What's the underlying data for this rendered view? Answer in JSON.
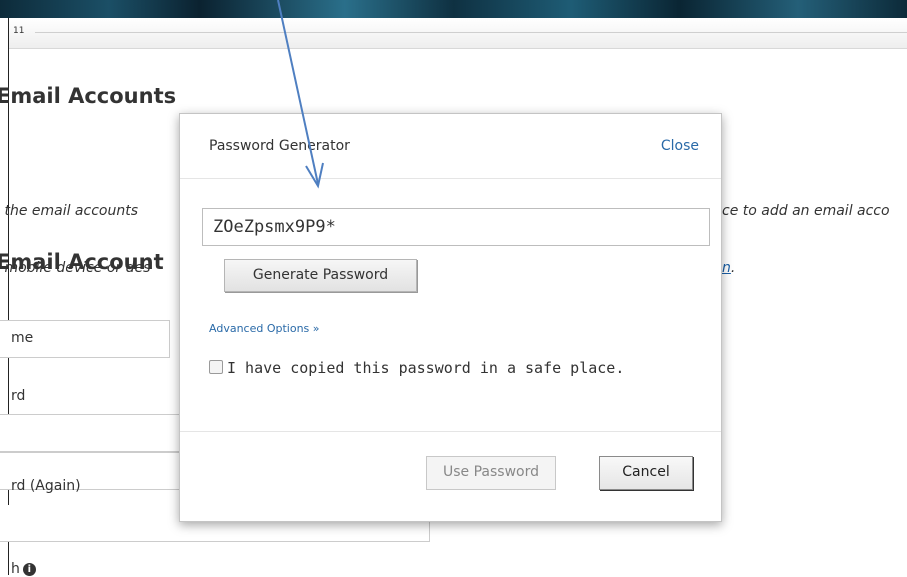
{
  "browser": {
    "tab_number": "11"
  },
  "page": {
    "title": "Email Accounts",
    "intro_left_line1": " the email accounts",
    "intro_left_line2": " mobile device or des",
    "intro_right_line1": "ce to add an email acco",
    "intro_right_line2_link": "n",
    "intro_right_line2_tail": ".",
    "section_title": "Email Account",
    "fields": {
      "username_label": "me",
      "password_label": "rd",
      "password_again_label": "rd (Again)",
      "strength_label": "h"
    }
  },
  "modal": {
    "title": "Password Generator",
    "close_label": "Close",
    "password_value": "ZOeZpsmx9P9*",
    "generate_button": "Generate Password",
    "advanced_link": "Advanced Options »",
    "copied_checkbox_label": "I have copied this password in a safe place.",
    "copied_checked": false,
    "use_button": "Use Password",
    "cancel_button": "Cancel"
  },
  "colors": {
    "link": "#2a6aa8",
    "arrow": "#4f7fc1",
    "banner": "#1b4f66"
  }
}
